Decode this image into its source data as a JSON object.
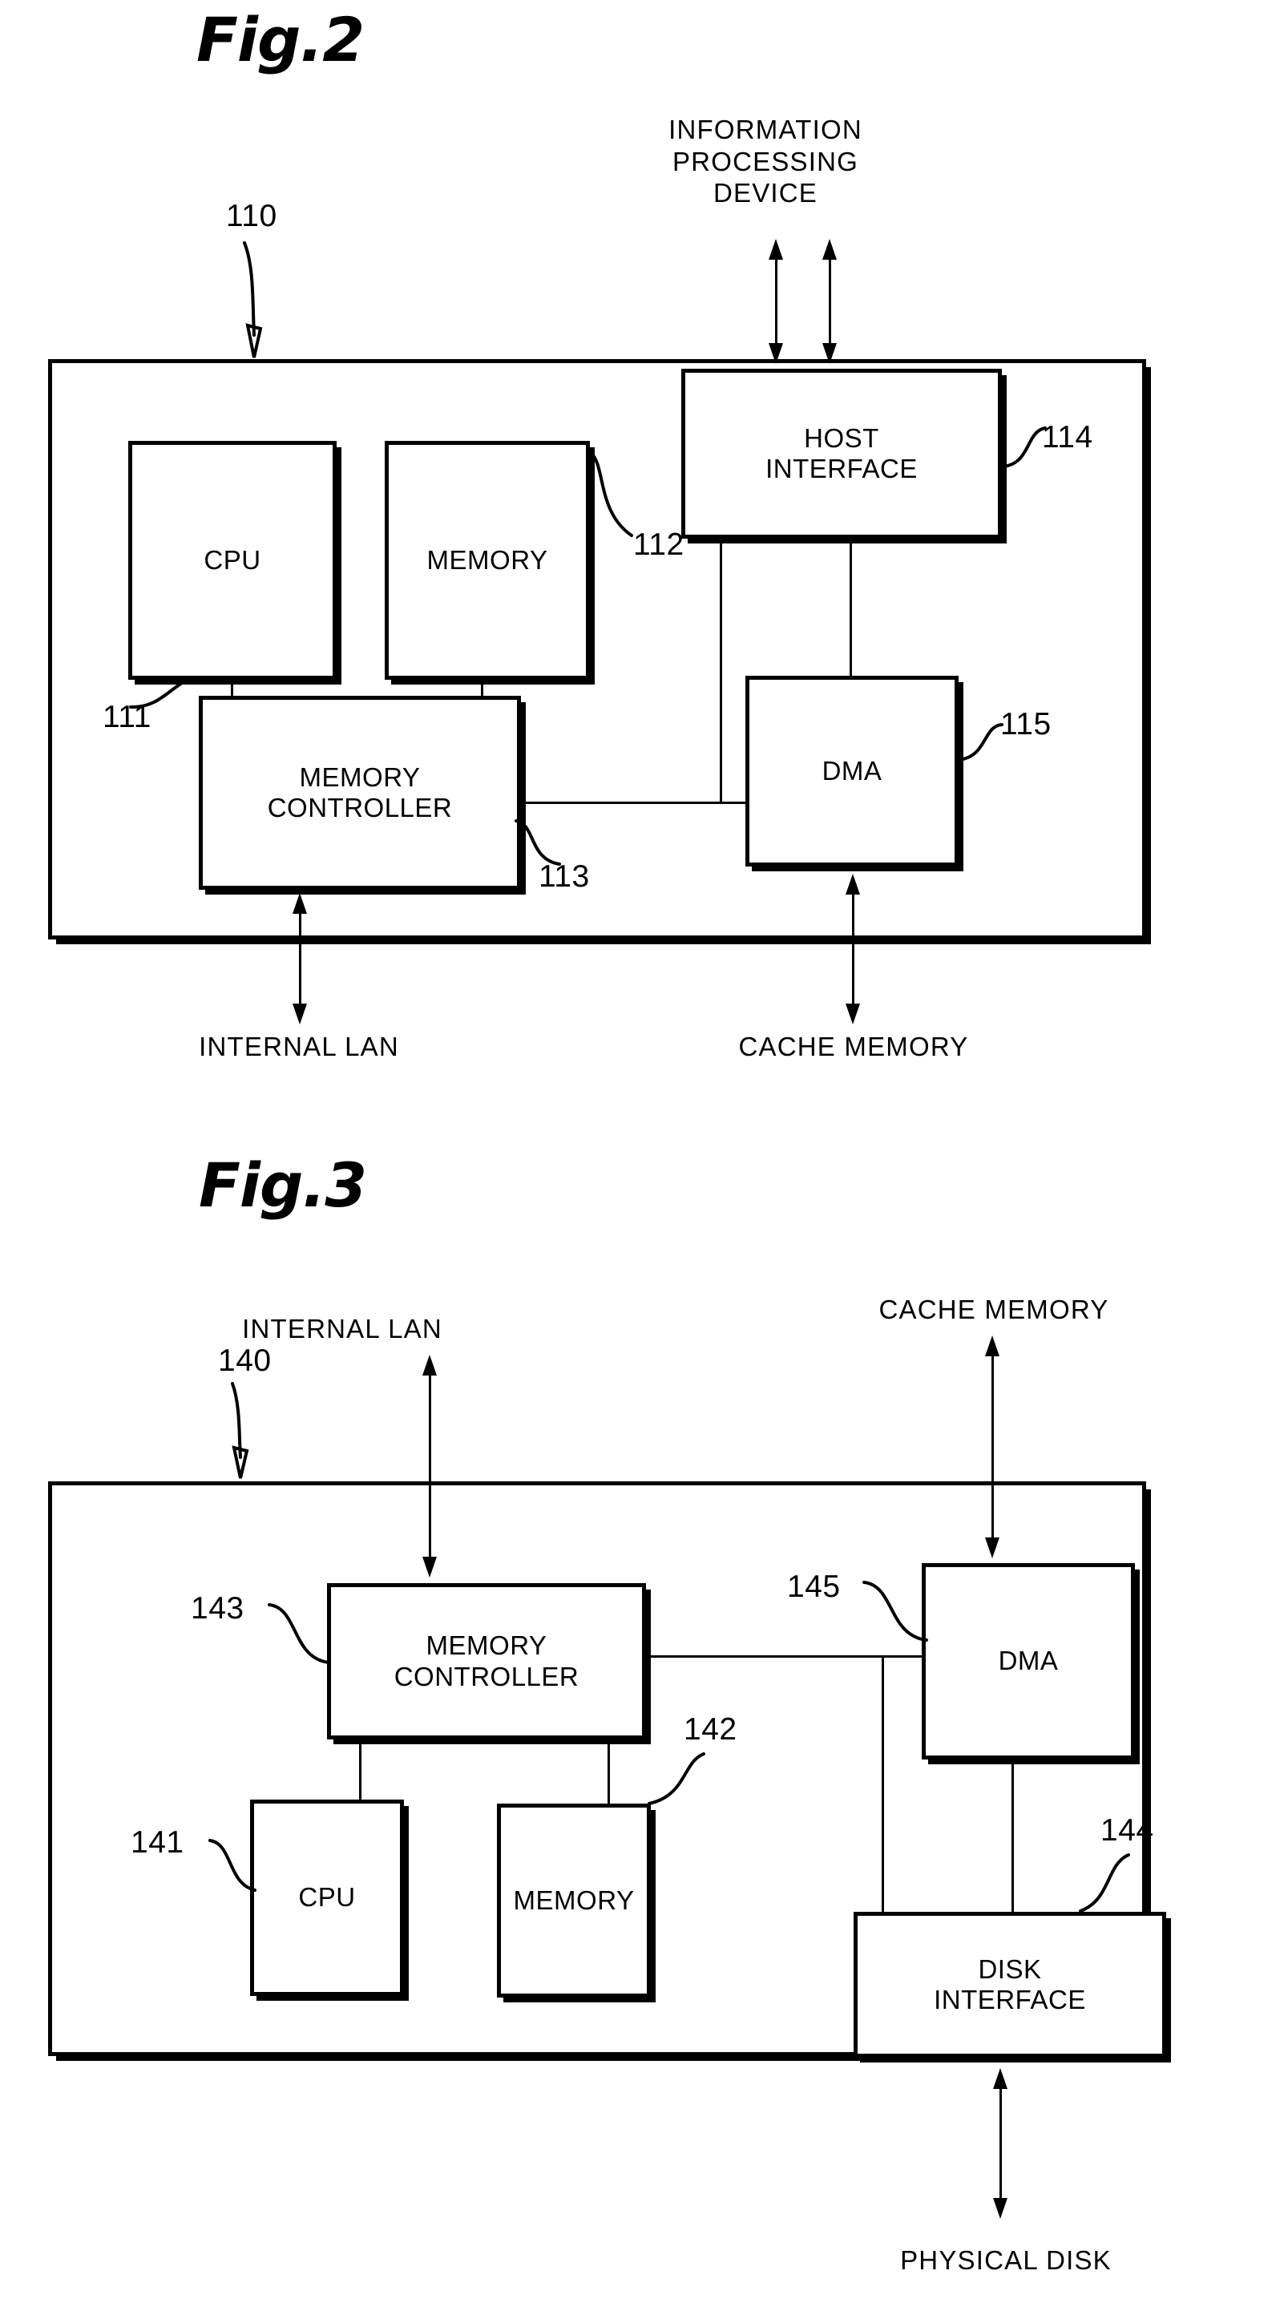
{
  "figures": [
    {
      "id": "fig2",
      "title": "Fig.2",
      "device_ref": "110",
      "external_labels": {
        "top": "INFORMATION\nPROCESSING\nDEVICE",
        "bottom_left": "INTERNAL LAN",
        "bottom_right": "CACHE MEMORY"
      },
      "blocks": [
        {
          "name": "cpu",
          "label": "CPU",
          "ref": "111"
        },
        {
          "name": "memory",
          "label": "MEMORY",
          "ref": "112"
        },
        {
          "name": "memory-controller",
          "label": "MEMORY\nCONTROLLER",
          "ref": "113"
        },
        {
          "name": "host-interface",
          "label": "HOST\nINTERFACE",
          "ref": "114"
        },
        {
          "name": "dma",
          "label": "DMA",
          "ref": "115"
        }
      ]
    },
    {
      "id": "fig3",
      "title": "Fig.3",
      "device_ref": "140",
      "external_labels": {
        "top_left": "INTERNAL LAN",
        "top_right": "CACHE MEMORY",
        "bottom": "PHYSICAL DISK"
      },
      "blocks": [
        {
          "name": "cpu",
          "label": "CPU",
          "ref": "141"
        },
        {
          "name": "memory",
          "label": "MEMORY",
          "ref": "142"
        },
        {
          "name": "memory-controller",
          "label": "MEMORY\nCONTROLLER",
          "ref": "143"
        },
        {
          "name": "disk-interface",
          "label": "DISK\nINTERFACE",
          "ref": "144"
        },
        {
          "name": "dma",
          "label": "DMA",
          "ref": "145"
        }
      ]
    }
  ],
  "colors": {
    "ink": "#000000",
    "paper": "#ffffff"
  }
}
